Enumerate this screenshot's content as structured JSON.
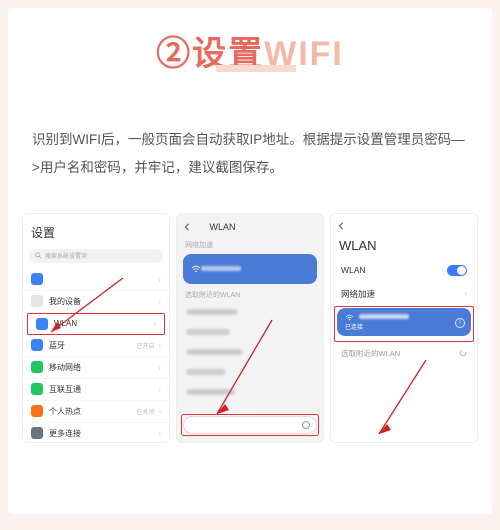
{
  "header": {
    "number": "②",
    "text1": "设置",
    "text2": "WIFI"
  },
  "description": "识别到WIFI后，一般页面会自动获取IP地址。根据提示设置管理员密码—>用户名和密码，并牢记，建议截图保存。",
  "phone1": {
    "title": "设置",
    "search_placeholder": "搜索系统设置项",
    "rows": [
      {
        "icon_bg": "#3b82f6",
        "label": "",
        "sub": ""
      },
      {
        "icon_bg": "#e5e5e5",
        "label": "我的设备",
        "sub": ""
      },
      {
        "icon_bg": "#3b82f6",
        "label": "WLAN",
        "sub": "",
        "highlight": true
      },
      {
        "icon_bg": "#3b82f6",
        "label": "蓝牙",
        "sub": "已开启"
      },
      {
        "icon_bg": "#22c55e",
        "label": "移动网络",
        "sub": ""
      },
      {
        "icon_bg": "#22c55e",
        "label": "互联互通",
        "sub": ""
      },
      {
        "icon_bg": "#f97316",
        "label": "个人热点",
        "sub": "已关闭"
      },
      {
        "icon_bg": "#6b7280",
        "label": "更多连接",
        "sub": ""
      }
    ]
  },
  "phone2": {
    "header": "WLAN",
    "section1": "网络加速",
    "section2": "选取附近的WLAN"
  },
  "phone3": {
    "title": "WLAN",
    "toggle_label": "WLAN",
    "accel_label": "网络加速",
    "connected_sub": "已连接",
    "nearby_label": "选取附近的WLAN"
  }
}
